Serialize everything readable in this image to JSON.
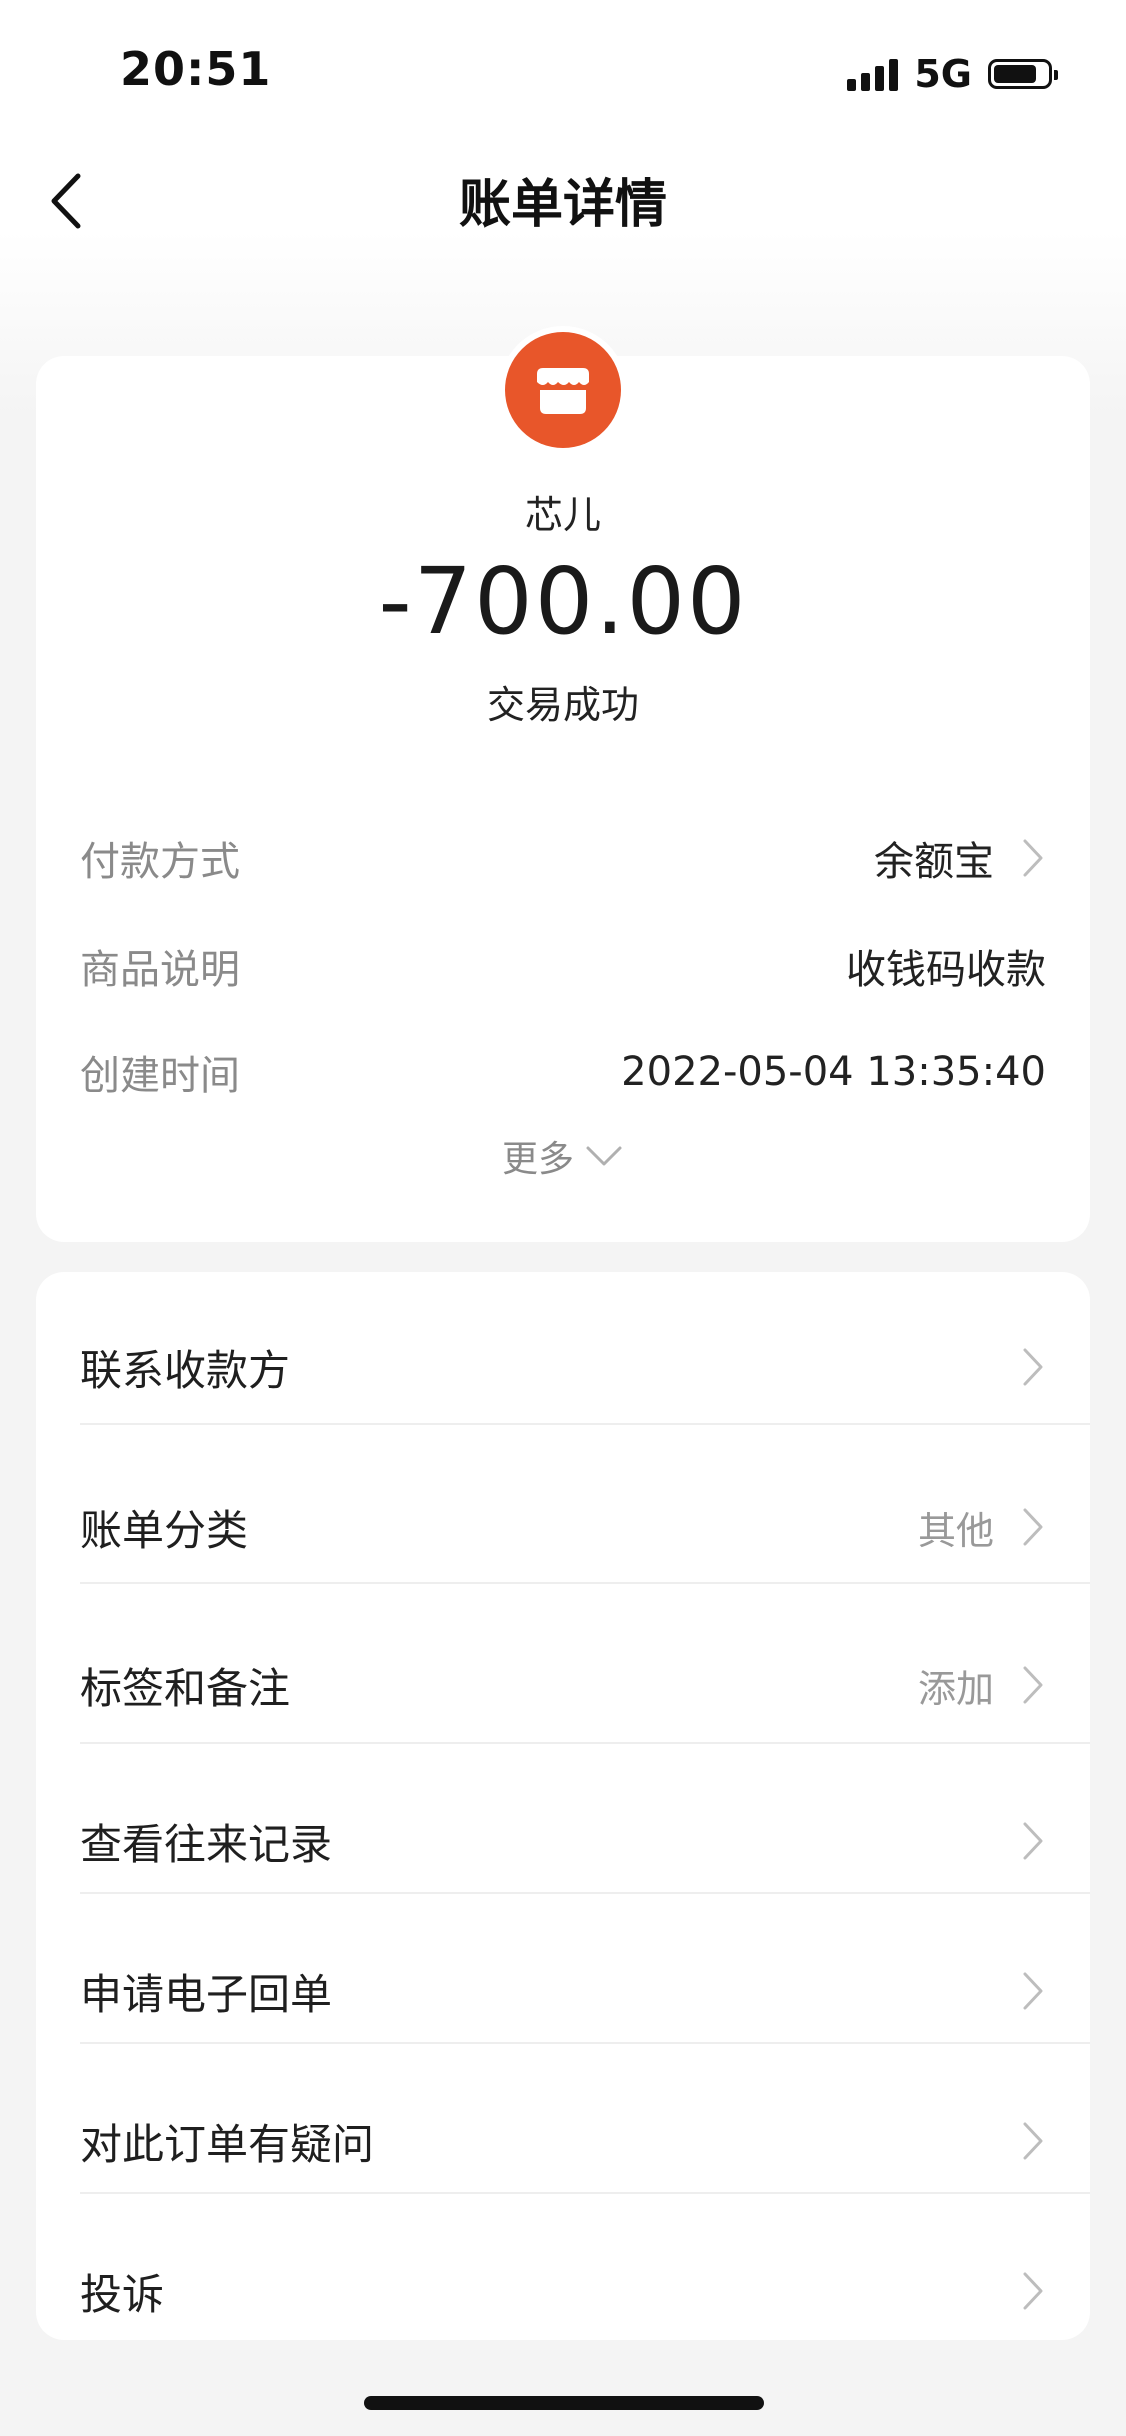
{
  "status_bar": {
    "time": "20:51",
    "network": "5G"
  },
  "nav": {
    "title": "账单详情",
    "back_icon": "chevron-left-icon"
  },
  "summary": {
    "merchant_icon": "storefront-icon",
    "merchant_color": "#e8562a",
    "merchant_name": "芯儿",
    "amount": "-700.00",
    "status": "交易成功",
    "details": [
      {
        "label": "付款方式",
        "value": "余额宝",
        "has_arrow": true
      },
      {
        "label": "商品说明",
        "value": "收钱码收款",
        "has_arrow": false
      },
      {
        "label": "创建时间",
        "value": "2022-05-04 13:35:40",
        "has_arrow": false
      }
    ],
    "more_label": "更多"
  },
  "actions": [
    {
      "label": "联系收款方",
      "sub": ""
    },
    {
      "label": "账单分类",
      "sub": "其他"
    },
    {
      "label": "标签和备注",
      "sub": "添加"
    },
    {
      "label": "查看往来记录",
      "sub": ""
    },
    {
      "label": "申请电子回单",
      "sub": ""
    },
    {
      "label": "对此订单有疑问",
      "sub": ""
    },
    {
      "label": "投诉",
      "sub": ""
    }
  ]
}
